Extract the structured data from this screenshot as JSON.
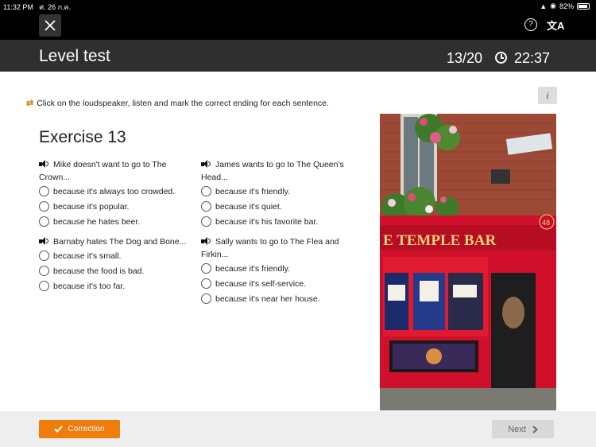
{
  "status": {
    "time": "11:32 PM",
    "date": "ศ. 26 ก.ค.",
    "battery": "82%",
    "battery_level": 0.82
  },
  "header": {
    "title": "Level test",
    "progress": "13/20",
    "timer": "22:37"
  },
  "instructions": "Click on the loudspeaker, listen and mark the correct ending for each sentence.",
  "info_label": "i",
  "exercise_title": "Exercise 13",
  "questions": [
    {
      "text": "Mike doesn't want to go to The Crown...",
      "options": [
        "because it's always too crowded.",
        "because it's popular.",
        "because he hates beer."
      ]
    },
    {
      "text": "James wants to go to The Queen's Head...",
      "options": [
        "because it's friendly.",
        "because it's quiet.",
        "because it's his favorite bar."
      ]
    },
    {
      "text": "Barnaby hates The Dog and Bone...",
      "options": [
        "because it's small.",
        "because the food is bad.",
        "because it's too far."
      ]
    },
    {
      "text": "Sally wants to go to The Flea and Firkin...",
      "options": [
        "because it's friendly.",
        "because it's self-service.",
        "because it's near her house."
      ]
    }
  ],
  "photo": {
    "sign_text": "E TEMPLE BAR",
    "number": "48"
  },
  "footer": {
    "correction_label": "Correction",
    "next_label": "Next"
  },
  "colors": {
    "accent": "#ef7d0b",
    "header_bg": "#2f2f2f",
    "pub_red": "#d0102a"
  }
}
